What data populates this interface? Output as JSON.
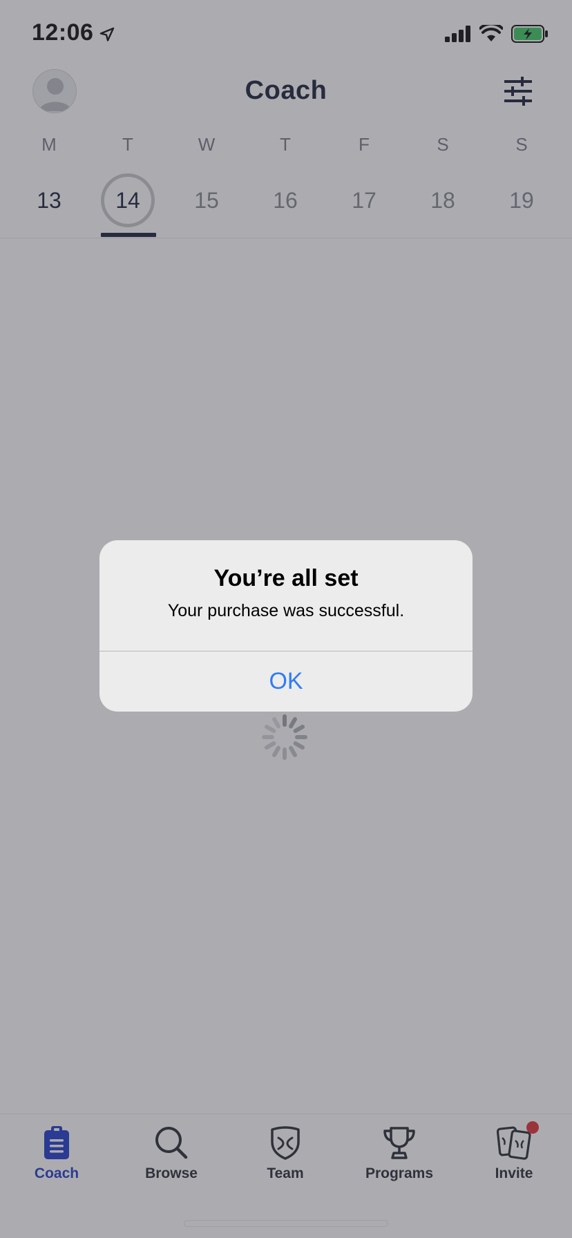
{
  "status_bar": {
    "time": "12:06"
  },
  "header": {
    "title": "Coach"
  },
  "week": {
    "days": [
      {
        "letter": "M",
        "number": "13"
      },
      {
        "letter": "T",
        "number": "14"
      },
      {
        "letter": "W",
        "number": "15"
      },
      {
        "letter": "T",
        "number": "16"
      },
      {
        "letter": "F",
        "number": "17"
      },
      {
        "letter": "S",
        "number": "18"
      },
      {
        "letter": "S",
        "number": "19"
      }
    ]
  },
  "alert": {
    "title": "You’re all set",
    "message": "Your purchase was successful.",
    "ok_label": "OK"
  },
  "tabbar": {
    "tabs": [
      {
        "label": "Coach",
        "icon": "clipboard-icon"
      },
      {
        "label": "Browse",
        "icon": "search-icon"
      },
      {
        "label": "Team",
        "icon": "shield-icon"
      },
      {
        "label": "Programs",
        "icon": "trophy-icon"
      },
      {
        "label": "Invite",
        "icon": "cards-icon"
      }
    ]
  },
  "colors": {
    "accent": "#1431c9",
    "alert_button": "#2f7cf6",
    "badge": "#e0242f",
    "title": "#0d1430"
  }
}
